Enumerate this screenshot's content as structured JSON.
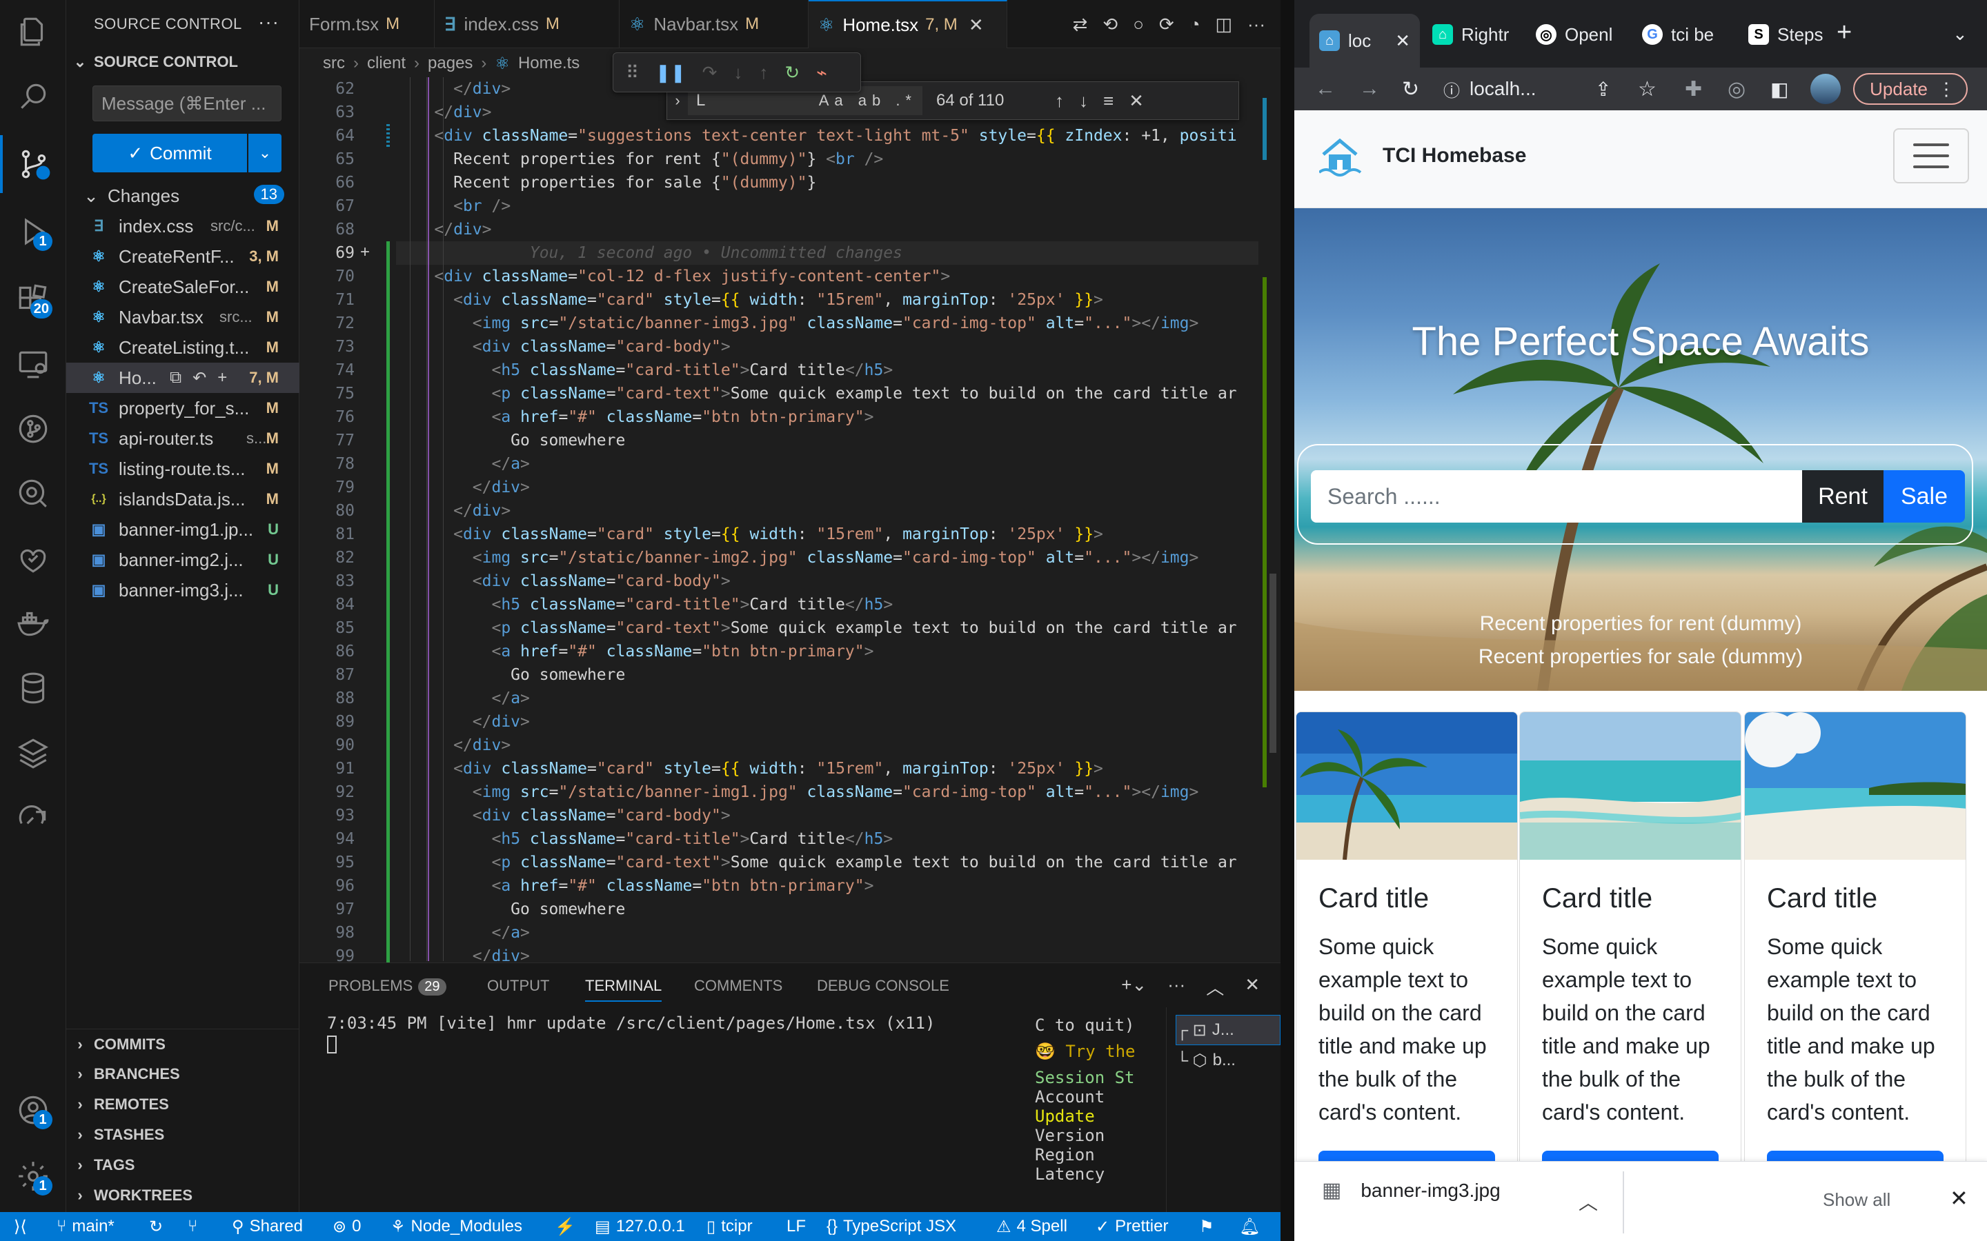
{
  "vscode": {
    "activity_badges": {
      "debug": "1",
      "extensions": "20",
      "accounts": "1",
      "settings": "1"
    },
    "sidebar": {
      "title": "SOURCE CONTROL",
      "section": "SOURCE CONTROL",
      "message_placeholder": "Message (⌘Enter ...",
      "commit_label": "Commit",
      "changes_label": "Changes",
      "changes_count": "13",
      "files": [
        {
          "name": "index.css",
          "path": "src/c...",
          "status": "M",
          "icon": "css-icon"
        },
        {
          "name": "CreateRentF...",
          "path": "",
          "status": "3, M",
          "icon": "react-icon"
        },
        {
          "name": "CreateSaleFor...",
          "path": "",
          "status": "M",
          "icon": "react-icon"
        },
        {
          "name": "Navbar.tsx",
          "path": "src...",
          "status": "M",
          "icon": "react-icon"
        },
        {
          "name": "CreateListing.t...",
          "path": "",
          "status": "M",
          "icon": "react-icon"
        },
        {
          "name": "Ho...",
          "path": "",
          "status": "7, M",
          "icon": "react-icon"
        },
        {
          "name": "property_for_s...",
          "path": "",
          "status": "M",
          "icon": "ts-icon"
        },
        {
          "name": "api-router.ts",
          "path": "s...",
          "status": "M",
          "icon": "ts-icon"
        },
        {
          "name": "listing-route.ts...",
          "path": "",
          "status": "M",
          "icon": "ts-icon"
        },
        {
          "name": "islandsData.js...",
          "path": "",
          "status": "M",
          "icon": "json-icon"
        },
        {
          "name": "banner-img1.jp...",
          "path": "",
          "status": "U",
          "icon": "image-icon"
        },
        {
          "name": "banner-img2.j...",
          "path": "",
          "status": "U",
          "icon": "image-icon"
        },
        {
          "name": "banner-img3.j...",
          "path": "",
          "status": "U",
          "icon": "image-icon"
        }
      ],
      "bottom_sections": [
        "COMMITS",
        "BRANCHES",
        "REMOTES",
        "STASHES",
        "TAGS",
        "WORKTREES"
      ]
    },
    "tabs": [
      {
        "label": "Form.tsx",
        "mod": "M",
        "icon": "react-icon"
      },
      {
        "label": "index.css",
        "mod": "M",
        "icon": "css-icon"
      },
      {
        "label": "Navbar.tsx",
        "mod": "M",
        "icon": "react-icon"
      },
      {
        "label": "Home.tsx",
        "mod": "7, M",
        "icon": "react-icon"
      }
    ],
    "breadcrumb": [
      "src",
      "client",
      "pages",
      "Home.ts"
    ],
    "find": {
      "query": "L",
      "count": "64 of 110",
      "options": "Aa ab .*"
    },
    "line_numbers": [
      "62",
      "63",
      "64",
      "65",
      "66",
      "67",
      "68",
      "69",
      "70",
      "71",
      "72",
      "73",
      "74",
      "75",
      "76",
      "77",
      "78",
      "79",
      "80",
      "81",
      "82",
      "83",
      "84",
      "85",
      "86",
      "87",
      "88",
      "89",
      "90",
      "91",
      "92",
      "93",
      "94",
      "95",
      "96",
      "97",
      "98",
      "99"
    ],
    "code_lines": [
      "      </div>",
      "    </div>",
      "    <div className=\"suggestions text-center text-light mt-5\" style={{ zIndex: +1, positi",
      "      Recent properties for rent {\"(dummy)\"} <br />",
      "      Recent properties for sale {\"(dummy)\"}",
      "      <br />",
      "    </div>",
      "              You, 1 second ago • Uncommitted changes",
      "    <div className=\"col-12 d-flex justify-content-center\">",
      "      <div className=\"card\" style={{ width: \"15rem\", marginTop: '25px' }}>",
      "        <img src=\"/static/banner-img3.jpg\" className=\"card-img-top\" alt=\"...\"></img>",
      "        <div className=\"card-body\">",
      "          <h5 className=\"card-title\">Card title</h5>",
      "          <p className=\"card-text\">Some quick example text to build on the card title ar",
      "          <a href=\"#\" className=\"btn btn-primary\">",
      "            Go somewhere",
      "          </a>",
      "        </div>",
      "      </div>",
      "      <div className=\"card\" style={{ width: \"15rem\", marginTop: '25px' }}>",
      "        <img src=\"/static/banner-img2.jpg\" className=\"card-img-top\" alt=\"...\"></img>",
      "        <div className=\"card-body\">",
      "          <h5 className=\"card-title\">Card title</h5>",
      "          <p className=\"card-text\">Some quick example text to build on the card title ar",
      "          <a href=\"#\" className=\"btn btn-primary\">",
      "            Go somewhere",
      "          </a>",
      "        </div>",
      "      </div>",
      "      <div className=\"card\" style={{ width: \"15rem\", marginTop: '25px' }}>",
      "        <img src=\"/static/banner-img1.jpg\" className=\"card-img-top\" alt=\"...\"></img>",
      "        <div className=\"card-body\">",
      "          <h5 className=\"card-title\">Card title</h5>",
      "          <p className=\"card-text\">Some quick example text to build on the card title ar",
      "          <a href=\"#\" className=\"btn btn-primary\">",
      "            Go somewhere",
      "          </a>",
      "        </div>"
    ],
    "panel": {
      "tabs": [
        "PROBLEMS",
        "OUTPUT",
        "TERMINAL",
        "COMMENTS",
        "DEBUG CONSOLE"
      ],
      "problems_count": "29",
      "terminal_line": "7:03:45 PM [vite] hmr update /src/client/pages/Home.tsx (x11)",
      "terminal_right": [
        "C to quit)",
        "",
        "🤓 Try the",
        "",
        "Session St",
        "Account",
        "Update",
        "Version",
        "Region",
        "Latency"
      ],
      "terminal_list": [
        "J...",
        "b..."
      ]
    },
    "status": {
      "branch": "main*",
      "shared": "Shared",
      "ports": "0",
      "node_modules": "Node_Modules",
      "host": "127.0.0.1",
      "db": "tcipr",
      "eol": "LF",
      "language": "TypeScript JSX",
      "spell": "4 Spell",
      "prettier": "Prettier"
    }
  },
  "chrome": {
    "tabs": [
      {
        "label": "loc",
        "favicon": "app-icon",
        "color": "#4a9fd8"
      },
      {
        "label": "Rightr",
        "favicon": "rightmove-icon",
        "color": "#00deb6"
      },
      {
        "label": "Openl",
        "favicon": "openai-icon",
        "color": "#ffffff"
      },
      {
        "label": "tci be",
        "favicon": "google-icon",
        "color": "#ffffff"
      },
      {
        "label": "Steps",
        "favicon": "steps-icon",
        "color": "#ffffff"
      }
    ],
    "url": "localh...",
    "update_label": "Update",
    "page": {
      "brand": "TCI Homebase",
      "hero_title": "The Perfect Space Awaits",
      "search_placeholder": "Search ......",
      "rent_label": "Rent",
      "sale_label": "Sale",
      "recent_rent": "Recent properties for rent (dummy)",
      "recent_sale": "Recent properties for sale (dummy)",
      "cards": [
        {
          "title": "Card title",
          "text": "Some quick example text to build on the card title and make up the bulk of the card's content."
        },
        {
          "title": "Card title",
          "text": "Some quick example text to build on the card title and make up the bulk of the card's content."
        },
        {
          "title": "Card title",
          "text": "Some quick example text to build on the card title and make up the bulk of the card's content."
        }
      ]
    },
    "download": {
      "filename": "banner-img3.jpg",
      "show_all": "Show all"
    }
  }
}
